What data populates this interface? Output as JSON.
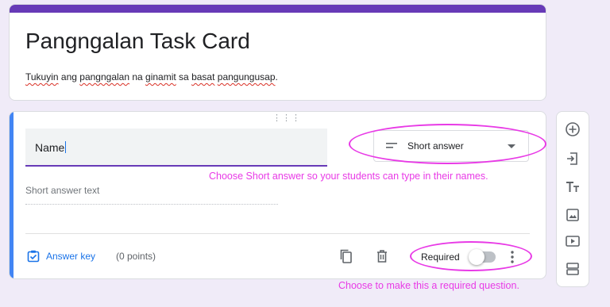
{
  "form": {
    "title": "Pangngalan Task Card",
    "description": {
      "w1": "Tukuyin",
      "s1": " ang ",
      "w2": "pangngalan",
      "s2": " na ",
      "w3": "ginamit",
      "s3": " sa ",
      "w4": "basat",
      "s4": " ",
      "w5": "pangungusap",
      "s5": "."
    }
  },
  "question": {
    "title": "Name",
    "type_label": "Short answer",
    "answer_placeholder": "Short answer text",
    "answer_key_label": "Answer key",
    "points": "(0 points)",
    "required_label": "Required",
    "required": false
  },
  "annotations": {
    "type_tip": "Choose Short answer so your students can type in their names.",
    "required_tip": "Choose to make this a required question."
  },
  "colors": {
    "theme": "#673ab7",
    "active_bar": "#4285f4",
    "link": "#1a73e8",
    "annotation": "#e83ae6",
    "background": "#f0ebf8"
  },
  "icons": {
    "toolbar": [
      "add-question-icon",
      "import-questions-icon",
      "add-title-icon",
      "add-image-icon",
      "add-video-icon",
      "add-section-icon"
    ],
    "footer": [
      "duplicate-icon",
      "delete-icon",
      "more-options-icon"
    ]
  }
}
